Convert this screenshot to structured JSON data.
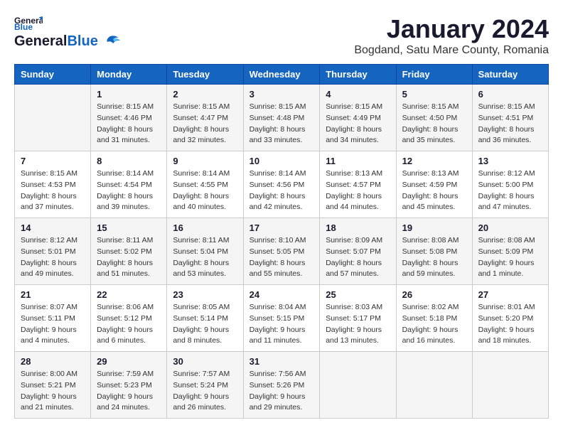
{
  "header": {
    "logo_general": "General",
    "logo_blue": "Blue",
    "month_title": "January 2024",
    "location": "Bogdand, Satu Mare County, Romania"
  },
  "days_of_week": [
    "Sunday",
    "Monday",
    "Tuesday",
    "Wednesday",
    "Thursday",
    "Friday",
    "Saturday"
  ],
  "weeks": [
    [
      {
        "day": "",
        "info": ""
      },
      {
        "day": "1",
        "info": "Sunrise: 8:15 AM\nSunset: 4:46 PM\nDaylight: 8 hours\nand 31 minutes."
      },
      {
        "day": "2",
        "info": "Sunrise: 8:15 AM\nSunset: 4:47 PM\nDaylight: 8 hours\nand 32 minutes."
      },
      {
        "day": "3",
        "info": "Sunrise: 8:15 AM\nSunset: 4:48 PM\nDaylight: 8 hours\nand 33 minutes."
      },
      {
        "day": "4",
        "info": "Sunrise: 8:15 AM\nSunset: 4:49 PM\nDaylight: 8 hours\nand 34 minutes."
      },
      {
        "day": "5",
        "info": "Sunrise: 8:15 AM\nSunset: 4:50 PM\nDaylight: 8 hours\nand 35 minutes."
      },
      {
        "day": "6",
        "info": "Sunrise: 8:15 AM\nSunset: 4:51 PM\nDaylight: 8 hours\nand 36 minutes."
      }
    ],
    [
      {
        "day": "7",
        "info": "Sunrise: 8:15 AM\nSunset: 4:53 PM\nDaylight: 8 hours\nand 37 minutes."
      },
      {
        "day": "8",
        "info": "Sunrise: 8:14 AM\nSunset: 4:54 PM\nDaylight: 8 hours\nand 39 minutes."
      },
      {
        "day": "9",
        "info": "Sunrise: 8:14 AM\nSunset: 4:55 PM\nDaylight: 8 hours\nand 40 minutes."
      },
      {
        "day": "10",
        "info": "Sunrise: 8:14 AM\nSunset: 4:56 PM\nDaylight: 8 hours\nand 42 minutes."
      },
      {
        "day": "11",
        "info": "Sunrise: 8:13 AM\nSunset: 4:57 PM\nDaylight: 8 hours\nand 44 minutes."
      },
      {
        "day": "12",
        "info": "Sunrise: 8:13 AM\nSunset: 4:59 PM\nDaylight: 8 hours\nand 45 minutes."
      },
      {
        "day": "13",
        "info": "Sunrise: 8:12 AM\nSunset: 5:00 PM\nDaylight: 8 hours\nand 47 minutes."
      }
    ],
    [
      {
        "day": "14",
        "info": "Sunrise: 8:12 AM\nSunset: 5:01 PM\nDaylight: 8 hours\nand 49 minutes."
      },
      {
        "day": "15",
        "info": "Sunrise: 8:11 AM\nSunset: 5:02 PM\nDaylight: 8 hours\nand 51 minutes."
      },
      {
        "day": "16",
        "info": "Sunrise: 8:11 AM\nSunset: 5:04 PM\nDaylight: 8 hours\nand 53 minutes."
      },
      {
        "day": "17",
        "info": "Sunrise: 8:10 AM\nSunset: 5:05 PM\nDaylight: 8 hours\nand 55 minutes."
      },
      {
        "day": "18",
        "info": "Sunrise: 8:09 AM\nSunset: 5:07 PM\nDaylight: 8 hours\nand 57 minutes."
      },
      {
        "day": "19",
        "info": "Sunrise: 8:08 AM\nSunset: 5:08 PM\nDaylight: 8 hours\nand 59 minutes."
      },
      {
        "day": "20",
        "info": "Sunrise: 8:08 AM\nSunset: 5:09 PM\nDaylight: 9 hours\nand 1 minute."
      }
    ],
    [
      {
        "day": "21",
        "info": "Sunrise: 8:07 AM\nSunset: 5:11 PM\nDaylight: 9 hours\nand 4 minutes."
      },
      {
        "day": "22",
        "info": "Sunrise: 8:06 AM\nSunset: 5:12 PM\nDaylight: 9 hours\nand 6 minutes."
      },
      {
        "day": "23",
        "info": "Sunrise: 8:05 AM\nSunset: 5:14 PM\nDaylight: 9 hours\nand 8 minutes."
      },
      {
        "day": "24",
        "info": "Sunrise: 8:04 AM\nSunset: 5:15 PM\nDaylight: 9 hours\nand 11 minutes."
      },
      {
        "day": "25",
        "info": "Sunrise: 8:03 AM\nSunset: 5:17 PM\nDaylight: 9 hours\nand 13 minutes."
      },
      {
        "day": "26",
        "info": "Sunrise: 8:02 AM\nSunset: 5:18 PM\nDaylight: 9 hours\nand 16 minutes."
      },
      {
        "day": "27",
        "info": "Sunrise: 8:01 AM\nSunset: 5:20 PM\nDaylight: 9 hours\nand 18 minutes."
      }
    ],
    [
      {
        "day": "28",
        "info": "Sunrise: 8:00 AM\nSunset: 5:21 PM\nDaylight: 9 hours\nand 21 minutes."
      },
      {
        "day": "29",
        "info": "Sunrise: 7:59 AM\nSunset: 5:23 PM\nDaylight: 9 hours\nand 24 minutes."
      },
      {
        "day": "30",
        "info": "Sunrise: 7:57 AM\nSunset: 5:24 PM\nDaylight: 9 hours\nand 26 minutes."
      },
      {
        "day": "31",
        "info": "Sunrise: 7:56 AM\nSunset: 5:26 PM\nDaylight: 9 hours\nand 29 minutes."
      },
      {
        "day": "",
        "info": ""
      },
      {
        "day": "",
        "info": ""
      },
      {
        "day": "",
        "info": ""
      }
    ]
  ]
}
